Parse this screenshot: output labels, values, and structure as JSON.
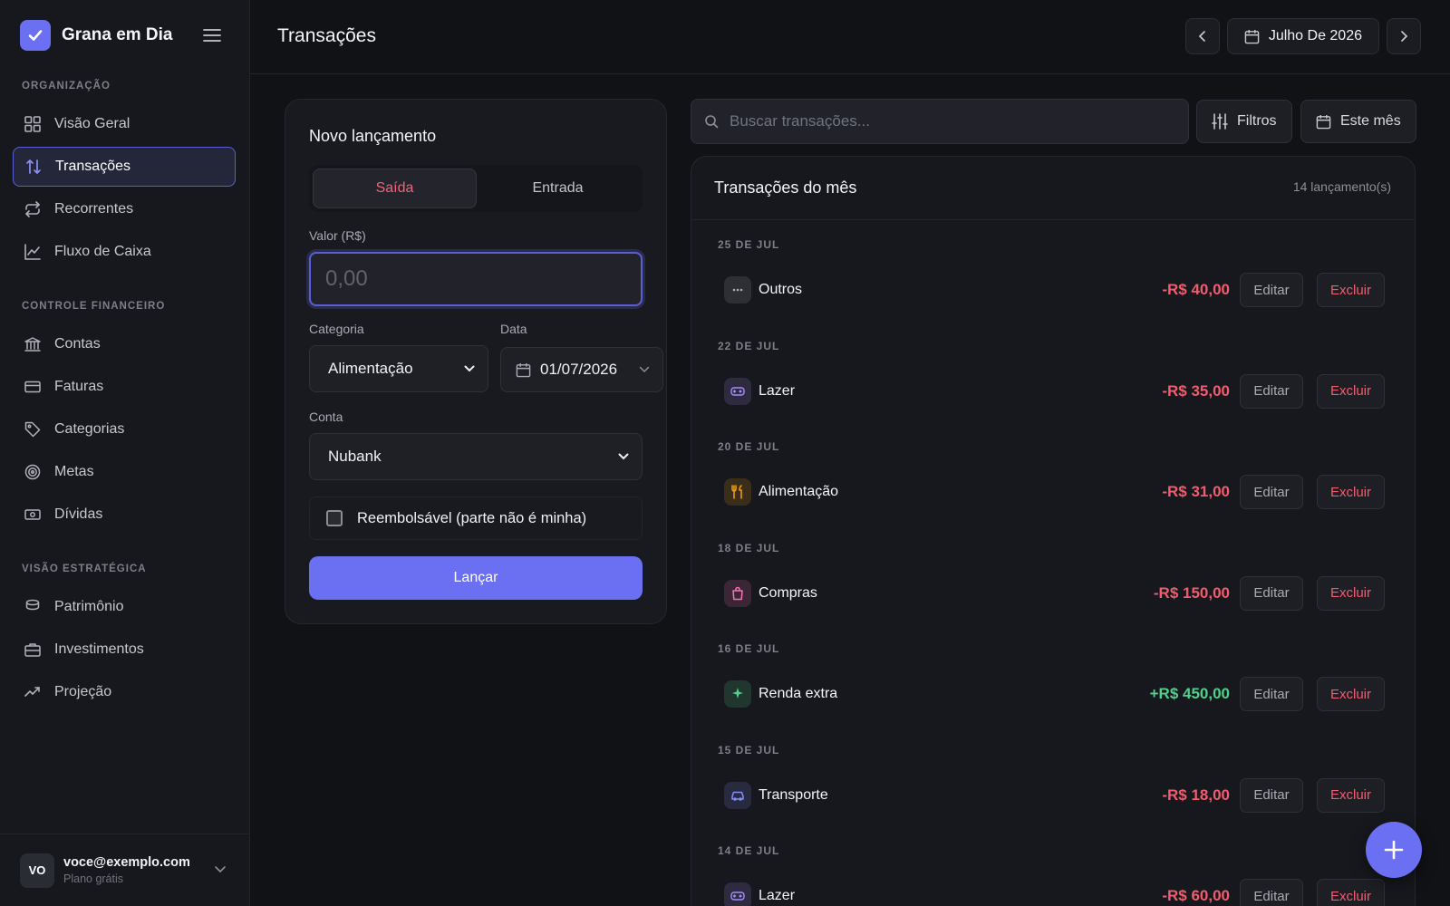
{
  "app": {
    "name": "Grana em Dia"
  },
  "sidebar": {
    "sections": [
      {
        "label": "ORGANIZAÇÃO",
        "items": [
          {
            "label": "Visão Geral",
            "icon": "grid-icon"
          },
          {
            "label": "Transações",
            "icon": "arrows-updown-icon",
            "active": true
          },
          {
            "label": "Recorrentes",
            "icon": "repeat-icon"
          },
          {
            "label": "Fluxo de Caixa",
            "icon": "line-chart-icon"
          }
        ]
      },
      {
        "label": "CONTROLE FINANCEIRO",
        "items": [
          {
            "label": "Contas",
            "icon": "bank-icon"
          },
          {
            "label": "Faturas",
            "icon": "credit-card-icon"
          },
          {
            "label": "Categorias",
            "icon": "tag-icon"
          },
          {
            "label": "Metas",
            "icon": "target-icon"
          },
          {
            "label": "Dívidas",
            "icon": "banknote-icon"
          }
        ]
      },
      {
        "label": "VISÃO ESTRATÉGICA",
        "items": [
          {
            "label": "Patrimônio",
            "icon": "database-icon"
          },
          {
            "label": "Investimentos",
            "icon": "briefcase-icon"
          },
          {
            "label": "Projeção",
            "icon": "trending-up-icon"
          }
        ]
      }
    ],
    "user": {
      "initials": "VO",
      "email": "voce@exemplo.com",
      "plan": "Plano grátis"
    }
  },
  "header": {
    "title": "Transações",
    "month_label": "Julho De 2026"
  },
  "form": {
    "title": "Novo lançamento",
    "tabs": [
      "Saída",
      "Entrada"
    ],
    "active_tab": "Saída",
    "amount_label": "Valor (R$)",
    "amount_placeholder": "0,00",
    "category_label": "Categoria",
    "category_value": "Alimentação",
    "date_label": "Data",
    "date_value": "01/07/2026",
    "account_label": "Conta",
    "account_value": "Nubank",
    "reimbursable_label": "Reembolsável (parte não é minha)",
    "reimbursable_checked": false,
    "submit_label": "Lançar"
  },
  "toolbar": {
    "search_placeholder": "Buscar transações...",
    "filters_label": "Filtros",
    "period_label": "Este mês"
  },
  "transactions": {
    "title": "Transações do mês",
    "count_label": "14 lançamento(s)",
    "edit_label": "Editar",
    "delete_label": "Excluir",
    "groups": [
      {
        "date": "25 DE JUL",
        "name": "Outros",
        "amount": "-R$ 40,00",
        "type": "out",
        "icon": "dots-icon",
        "color": "#a8abb6"
      },
      {
        "date": "22 DE JUL",
        "name": "Lazer",
        "amount": "-R$ 35,00",
        "type": "out",
        "icon": "gamepad-icon",
        "color": "#a78bfa"
      },
      {
        "date": "20 DE JUL",
        "name": "Alimentação",
        "amount": "-R$ 31,00",
        "type": "out",
        "icon": "utensils-icon",
        "color": "#f59e0b"
      },
      {
        "date": "18 DE JUL",
        "name": "Compras",
        "amount": "-R$ 150,00",
        "type": "out",
        "icon": "shopping-bag-icon",
        "color": "#f472b6"
      },
      {
        "date": "16 DE JUL",
        "name": "Renda extra",
        "amount": "+R$ 450,00",
        "type": "in",
        "icon": "sparkles-icon",
        "color": "#4fd18b"
      },
      {
        "date": "15 DE JUL",
        "name": "Transporte",
        "amount": "-R$ 18,00",
        "type": "out",
        "icon": "car-icon",
        "color": "#818cf8"
      },
      {
        "date": "14 DE JUL",
        "name": "Lazer",
        "amount": "-R$ 60,00",
        "type": "out",
        "icon": "gamepad-icon",
        "color": "#a78bfa"
      }
    ]
  },
  "colors": {
    "accent": "#6b70f2",
    "negative": "#ef5d6f",
    "positive": "#4fd18b",
    "background": "#111216"
  }
}
